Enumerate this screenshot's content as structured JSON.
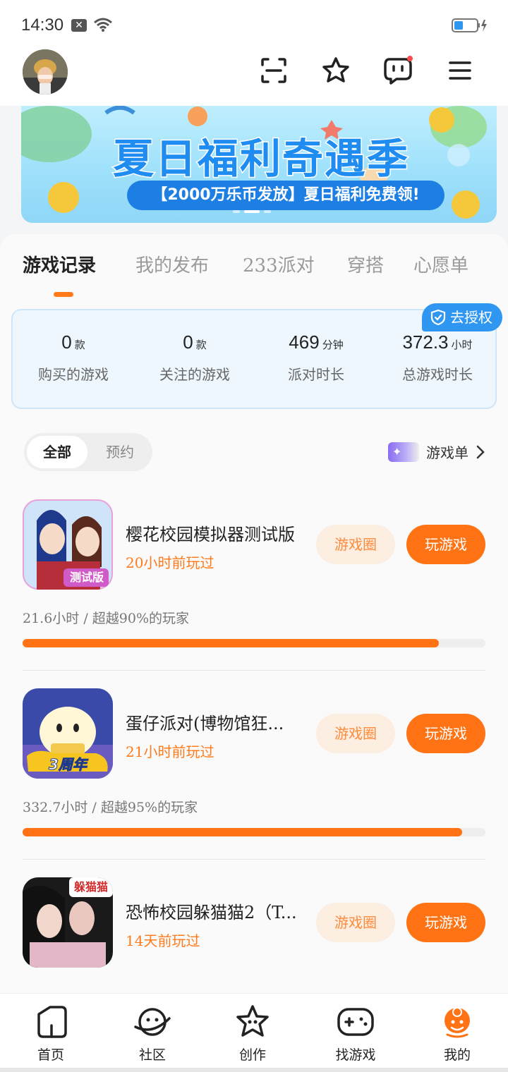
{
  "status_bar": {
    "time": "14:30"
  },
  "banner": {
    "title": "夏日福利奇遇季",
    "subtitle": "【2000万乐币发放】夏日福利免费领!"
  },
  "tabs": [
    {
      "label": "游戏记录",
      "active": true
    },
    {
      "label": "我的发布",
      "active": false
    },
    {
      "label": "233派对",
      "active": false
    },
    {
      "label": "穿搭",
      "active": false
    },
    {
      "label": "心愿单",
      "active": false
    }
  ],
  "stats": {
    "auth_label": "去授权",
    "items": [
      {
        "value": "0",
        "unit": "款",
        "label": "购买的游戏"
      },
      {
        "value": "0",
        "unit": "款",
        "label": "关注的游戏"
      },
      {
        "value": "469",
        "unit": "分钟",
        "label": "派对时长"
      },
      {
        "value": "372.3",
        "unit": "小时",
        "label": "总游戏时长"
      }
    ]
  },
  "filter": {
    "all": "全部",
    "reserve": "预约"
  },
  "game_list_link": "游戏单",
  "games": [
    {
      "name": "樱花校园模拟器测试版",
      "last_played": "20小时前玩过",
      "stats": "21.6小时 / 超越90%的玩家",
      "progress": 0.9,
      "circle_label": "游戏圈",
      "play_label": "玩游戏",
      "icon_badge": "测试版"
    },
    {
      "name": "蛋仔派对(博物馆狂...",
      "last_played": "21小时前玩过",
      "stats": "332.7小时 / 超越95%的玩家",
      "progress": 0.95,
      "circle_label": "游戏圈",
      "play_label": "玩游戏",
      "icon_badge": "3周年"
    },
    {
      "name": "恐怖校园躲猫猫2（T...",
      "last_played": "14天前玩过",
      "stats": "",
      "progress": 0,
      "circle_label": "游戏圈",
      "play_label": "玩游戏",
      "icon_badge": "躲猫猫"
    }
  ],
  "bottom_nav": [
    {
      "label": "首页",
      "icon": "home-icon"
    },
    {
      "label": "社区",
      "icon": "community-planet-icon"
    },
    {
      "label": "创作",
      "icon": "create-star-icon"
    },
    {
      "label": "找游戏",
      "icon": "gamepad-icon"
    },
    {
      "label": "我的",
      "icon": "profile-face-icon",
      "active": true
    }
  ],
  "colors": {
    "accent": "#ff7315",
    "blue": "#2f97f2"
  }
}
